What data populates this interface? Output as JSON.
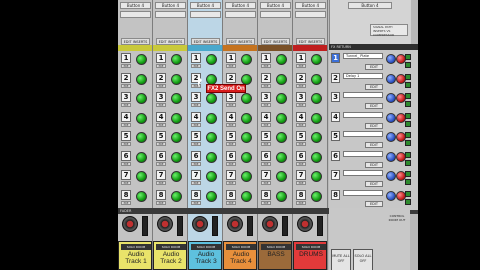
{
  "top_buttons": {
    "label": "Button 4"
  },
  "edit_inserts": "EDIT INSERTS",
  "signal_patch": {
    "title": "SIGNAL PATH",
    "line1": "INSERTS VS",
    "line2": "COMPRESSOR"
  },
  "fx_panel": {
    "header": "FX RETURN",
    "rows": [
      {
        "num": "1",
        "field": "Tunnel_ Plate",
        "edit": "EDIT",
        "active": true
      },
      {
        "num": "2",
        "field": "Delay 1",
        "edit": "EDIT",
        "active": false
      },
      {
        "num": "3",
        "field": "",
        "edit": "EDIT",
        "active": false
      },
      {
        "num": "4",
        "field": "",
        "edit": "EDIT",
        "active": false
      },
      {
        "num": "5",
        "field": "",
        "edit": "EDIT",
        "active": false
      },
      {
        "num": "6",
        "field": "",
        "edit": "EDIT",
        "active": false
      },
      {
        "num": "7",
        "field": "",
        "edit": "EDIT",
        "active": false
      },
      {
        "num": "8",
        "field": "",
        "edit": "EDIT",
        "active": false
      }
    ]
  },
  "fx_sends": [
    "1",
    "2",
    "3",
    "4",
    "5",
    "6",
    "7",
    "8"
  ],
  "pre_label": "PRE",
  "fader_header": {
    "left": "FADER",
    "right": "FADER"
  },
  "popup": "FX2 Send On",
  "master": {
    "control_room": "CONTROL ROOM OUT",
    "btn_left": "MUTE ALL OFF",
    "btn_right": "SOLO ALL OFF"
  },
  "tracks": [
    {
      "name": "Audio Track 1",
      "color": "#e9e36a",
      "strip": "#c9c93a",
      "selected": false,
      "mini": "SOLO ROOM"
    },
    {
      "name": "Audio Track 2",
      "color": "#e9e36a",
      "strip": "#c9c93a",
      "selected": false,
      "mini": "SOLO ROOM"
    },
    {
      "name": "Audio Track 3",
      "color": "#5ec1de",
      "strip": "#4aa8cc",
      "selected": true,
      "mini": "SOLO ROOM"
    },
    {
      "name": "Audio Track 4",
      "color": "#e88f3b",
      "strip": "#c5731f",
      "selected": false,
      "mini": "SOLO ROOM"
    },
    {
      "name": "BASS",
      "color": "#9b6a3a",
      "strip": "#7a5128",
      "selected": false,
      "mini": "SOLO ROOM"
    },
    {
      "name": "DRUMS",
      "color": "#e23a3a",
      "strip": "#c01f1f",
      "selected": false,
      "mini": "SOLO ROOM"
    }
  ],
  "colors": {
    "panel": "#c3c3c3",
    "knob": "#1aa51a",
    "accent_red": "#d81b1b"
  }
}
